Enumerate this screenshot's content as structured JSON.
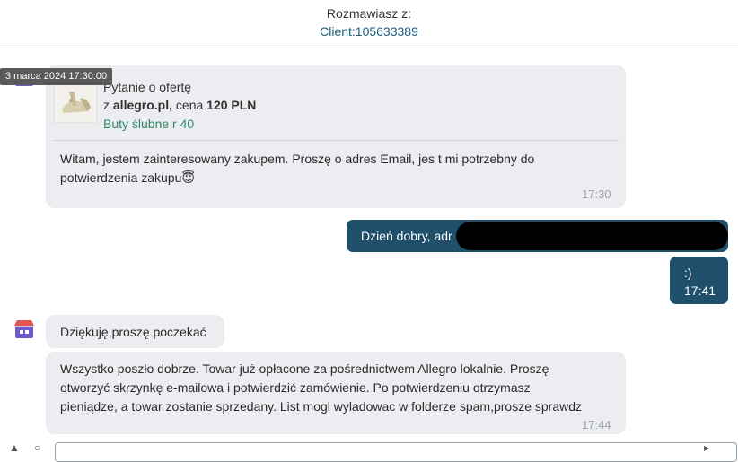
{
  "header": {
    "label": "Rozmawiasz z:",
    "client": "Client:105633389"
  },
  "timestamp_tooltip": "3 marca 2024 17:30:00",
  "offer_message": {
    "title": "Pytanie o ofertę",
    "source_prefix": "z ",
    "source_site": "allegro.pl,",
    "price_prefix": " cena ",
    "price": "120 PLN",
    "product": "Buty ślubne r 40",
    "text_line1": "Witam, jestem zainteresowany zakupem. Proszę o adres Email, jes t mi potrzebny do",
    "text_line2": "potwierdzenia zakupu😇",
    "time": "17:30"
  },
  "outgoing": [
    {
      "text": "Dzień dobry, adr"
    },
    {
      "text": ":)",
      "time": "17:41"
    }
  ],
  "incoming": [
    {
      "text": "Dziękuję,proszę poczekać"
    },
    {
      "line1": "Wszystko poszło dobrze. Towar już opłacone za pośrednictwem Allegro lokalnie. Proszę",
      "line2": "otworzyć skrzynkę e-mailowa i potwierdzić zamówienie. Po potwierdzeniu otrzymasz",
      "line3": "pieniądze, a towar zostanie sprzedany. List mogl wyladowac w folderze spam,prosze sprawdz",
      "time": "17:44"
    }
  ],
  "colors": {
    "incoming_bg": "#ecedf0",
    "outgoing_bg": "#1f4f6b",
    "link": "#2e8a6a"
  },
  "icons": [
    "shop-avatar-icon",
    "attachment-icon",
    "emoji-icon",
    "send-icon"
  ]
}
